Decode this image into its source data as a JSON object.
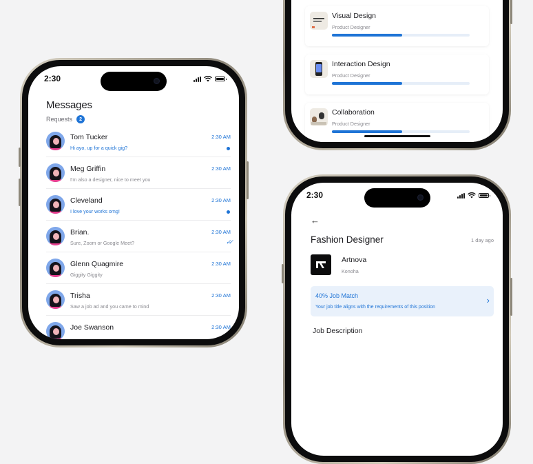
{
  "status_bar": {
    "time": "2:30"
  },
  "messages": {
    "title": "Messages",
    "requests_label": "Requests",
    "requests_count": "2",
    "conversations": [
      {
        "name": "Tom Tucker",
        "preview": "Hi ayo, up for a quick gig?",
        "time": "2:30 AM",
        "state": "unread"
      },
      {
        "name": "Meg Griffin",
        "preview": "I'm also a designer, nice to meet you",
        "time": "2:30 AM",
        "state": "read"
      },
      {
        "name": "Cleveland",
        "preview": "I love your works omg!",
        "time": "2:30 AM",
        "state": "unread"
      },
      {
        "name": "Brian.",
        "preview": "Sure, Zoom or Google Meet?",
        "time": "2:30 AM",
        "state": "seen"
      },
      {
        "name": "Glenn Quagmire",
        "preview": "Giggity Giggity",
        "time": "2:30 AM",
        "state": "read"
      },
      {
        "name": "Trisha",
        "preview": "Saw a job ad and you came to mind",
        "time": "2:30 AM",
        "state": "read"
      },
      {
        "name": "Joe Swanson",
        "preview": "",
        "time": "2:30 AM",
        "state": "read"
      }
    ]
  },
  "skills": {
    "items": [
      {
        "title": "Visual Design",
        "subtitle": "Product Designer",
        "progress": 0.51,
        "icon": "visual-design-thumbnail"
      },
      {
        "title": "Interaction Design",
        "subtitle": "Product Designer",
        "progress": 0.51,
        "icon": "phone-mockup-thumbnail"
      },
      {
        "title": "Collaboration",
        "subtitle": "Product Designer",
        "progress": 0.51,
        "icon": "team-photo-thumbnail"
      }
    ]
  },
  "job": {
    "title": "Fashion Designer",
    "posted": "1 day ago",
    "company": "Artnova",
    "location": "Konoha",
    "match_title": "40% Job Match",
    "match_subtitle": "Your job title aligns with the requirements of this position",
    "section_heading": "Job Description"
  },
  "colors": {
    "accent": "#1f74d6",
    "background": "#f3f3f4",
    "frame": "#b7b0a1"
  }
}
